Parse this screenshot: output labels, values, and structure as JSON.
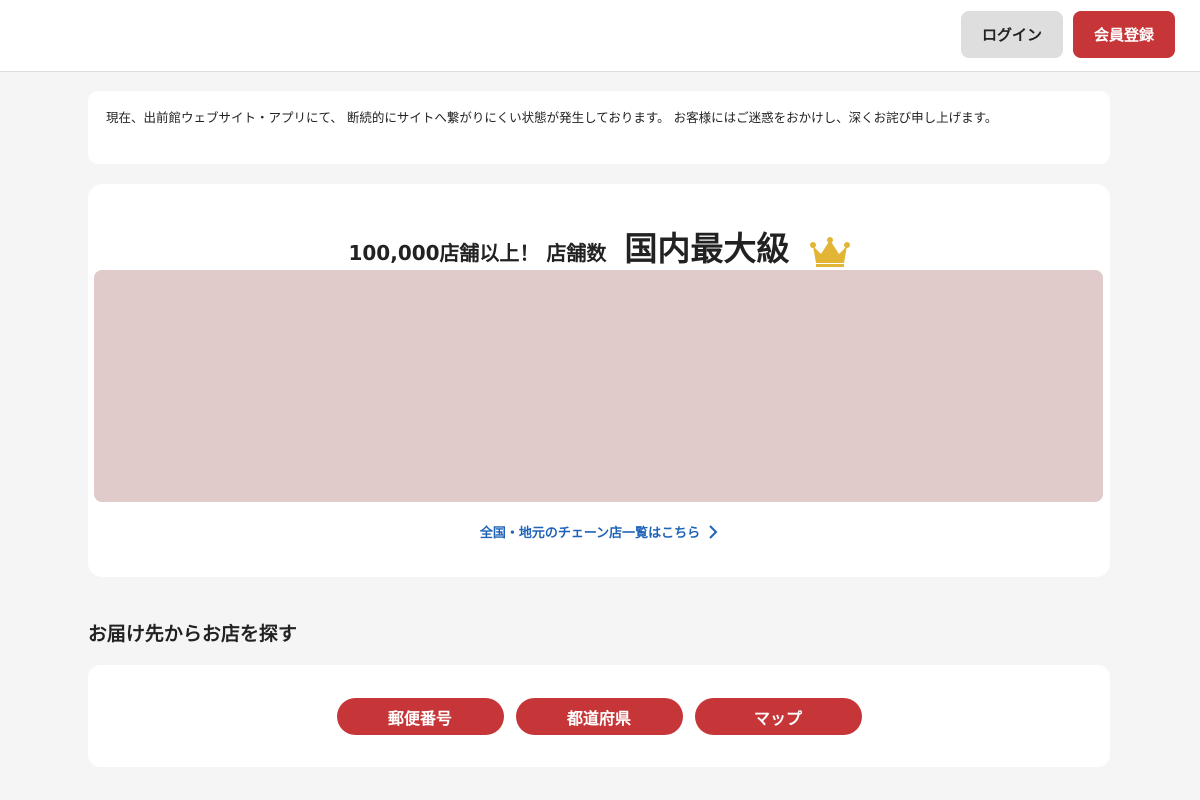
{
  "header": {
    "login_label": "ログイン",
    "signup_label": "会員登録"
  },
  "notice": {
    "text": "現在、出前館ウェブサイト・アプリにて、 断続的にサイトへ繋がりにくい状態が発生しております。 お客様にはご迷惑をおかけし、深くお詫び申し上げます。"
  },
  "promo": {
    "subheadline": "100,000店舗以上！ 店舗数",
    "headline": "国内最大級",
    "chain_link_label": "全国・地元のチェーン店一覧はこちら"
  },
  "search_section": {
    "title": "お届け先からお店を探す",
    "buttons": [
      "郵便番号",
      "都道府県",
      "マップ"
    ]
  },
  "colors": {
    "brand_red": "#c63538",
    "link_blue": "#1f63b8",
    "crown_gold": "#e2b634",
    "banner_placeholder": "#e0cbca"
  },
  "icons": {
    "crown": "crown-icon",
    "chevron": "chevron-right-icon"
  }
}
